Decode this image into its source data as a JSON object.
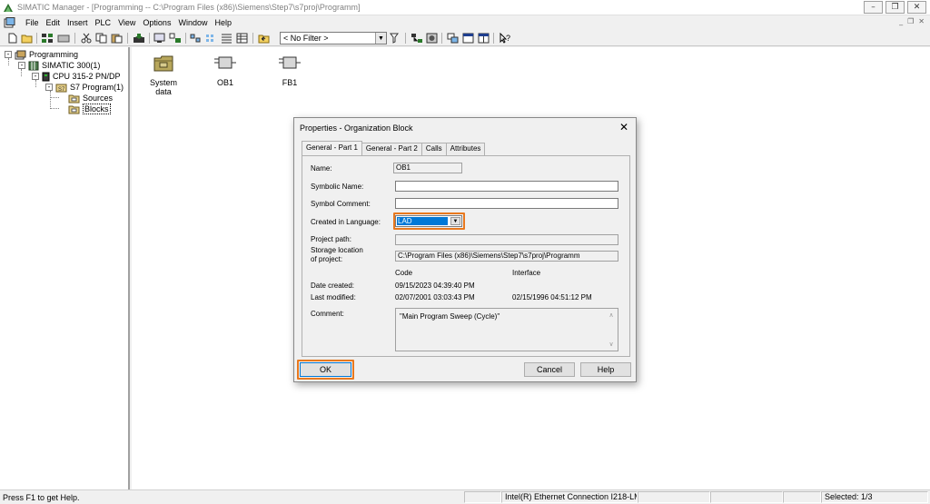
{
  "window": {
    "title": "SIMATIC Manager - [Programming -- C:\\Program Files (x86)\\Siemens\\Step7\\s7proj\\Programm]",
    "controls": [
      "minimize-restore",
      "restore",
      "close"
    ]
  },
  "menu": {
    "items": [
      "File",
      "Edit",
      "Insert",
      "PLC",
      "View",
      "Options",
      "Window",
      "Help"
    ]
  },
  "toolbar": {
    "filter_value": "< No Filter >"
  },
  "tree": {
    "nodes": [
      {
        "label": "Programming",
        "icon": "project-icon",
        "toggle": "-"
      },
      {
        "label": "SIMATIC 300(1)",
        "icon": "station-icon",
        "toggle": "-"
      },
      {
        "label": "CPU 315-2 PN/DP",
        "icon": "cpu-icon",
        "toggle": "-"
      },
      {
        "label": "S7 Program(1)",
        "icon": "program-folder-icon",
        "toggle": "-"
      },
      {
        "label": "Sources",
        "icon": "folder-icon"
      },
      {
        "label": "Blocks",
        "icon": "folder-icon",
        "selected": true
      }
    ]
  },
  "objects": {
    "items": [
      {
        "label": "System data",
        "icon": "system-data-icon"
      },
      {
        "label": "OB1",
        "icon": "block-icon"
      },
      {
        "label": "FB1",
        "icon": "block-icon"
      }
    ]
  },
  "status": {
    "help": "Press F1 to get Help.",
    "interface": "Intel(R) Ethernet Connection I218-LM",
    "selected": "Selected:  1/3"
  },
  "dialog": {
    "title": "Properties - Organization Block",
    "tabs": [
      "General - Part 1",
      "General - Part 2",
      "Calls",
      "Attributes"
    ],
    "active_tab": "General - Part 1",
    "labels": {
      "name": "Name:",
      "symbolic_name": "Symbolic Name:",
      "symbol_comment": "Symbol Comment:",
      "created_in_language": "Created in Language:",
      "project_path": "Project path:",
      "storage_location_1": "Storage location",
      "storage_location_2": "of project:",
      "code": "Code",
      "interface": "Interface",
      "date_created": "Date created:",
      "last_modified": "Last modified:",
      "comment": "Comment:"
    },
    "values": {
      "name": "OB1",
      "symbolic_name": "",
      "symbol_comment": "",
      "language": "LAD",
      "project_path": "",
      "storage_location": "C:\\Program Files (x86)\\Siemens\\Step7\\s7proj\\Programm",
      "date_created_code": "09/15/2023 04:39:40 PM",
      "last_modified_code": "02/07/2001 03:03:43 PM",
      "last_modified_interface": "02/15/1996 04:51:12 PM",
      "comment": "\"Main Program Sweep (Cycle)\""
    },
    "buttons": {
      "ok": "OK",
      "cancel": "Cancel",
      "help": "Help"
    },
    "highlight_color": "#e8781e"
  }
}
